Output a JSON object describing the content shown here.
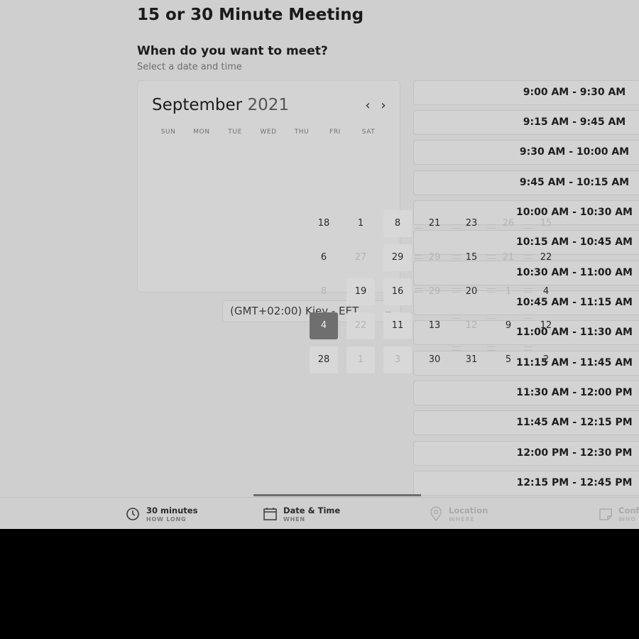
{
  "header": {
    "title": "15 or 30 Minute Meeting",
    "section_heading": "When do you want to meet?",
    "section_sub": "Select a date and time"
  },
  "calendar": {
    "month": "September",
    "year": "2021",
    "prev_glyph": "‹",
    "next_glyph": "›",
    "weekdays": [
      "SUN",
      "MON",
      "TUE",
      "WED",
      "THU",
      "FRI",
      "SAT"
    ],
    "selected_color": "#6f6f6f",
    "days": [
      [
        "18",
        "1",
        "8",
        "21",
        "23",
        "26",
        "15"
      ],
      [
        "6",
        "27",
        "29",
        "29",
        "15",
        "21",
        "22"
      ],
      [
        "8",
        "19",
        "16",
        "29",
        "20",
        "1",
        "4"
      ],
      [
        "4",
        "22",
        "11",
        "13",
        "12",
        "9",
        "12"
      ],
      [
        "28",
        "1",
        "3",
        "30",
        "31",
        "5",
        "2"
      ]
    ]
  },
  "timezone": {
    "value": "(GMT+02:00) Kiev - EET"
  },
  "slots": [
    "9:00 AM - 9:30 AM",
    "9:15 AM - 9:45 AM",
    "9:30 AM - 10:00 AM",
    "9:45 AM - 10:15 AM",
    "10:00 AM - 10:30 AM",
    "10:15 AM - 10:45 AM",
    "10:30 AM - 11:00 AM",
    "10:45 AM - 11:15 AM",
    "11:00 AM - 11:30 AM",
    "11:15 AM - 11:45 AM",
    "11:30 AM - 12:00 PM",
    "11:45 AM - 12:15 PM",
    "12:00 PM - 12:30 PM",
    "12:15 PM - 12:45 PM"
  ],
  "steps": [
    {
      "label": "30 minutes",
      "sub": "HOW LONG",
      "icon": "clock-icon"
    },
    {
      "label": "Date & Time",
      "sub": "WHEN",
      "icon": "calendar-icon"
    },
    {
      "label": "Location",
      "sub": "WHERE",
      "icon": "map-pin-icon"
    },
    {
      "label": "Confirm",
      "sub": "WHO",
      "icon": "note-icon"
    }
  ]
}
